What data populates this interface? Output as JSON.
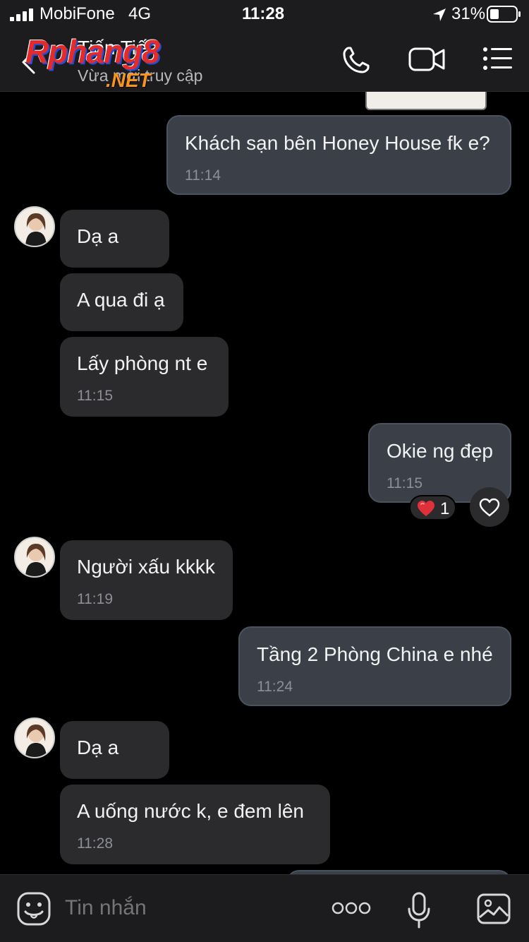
{
  "status": {
    "carrier": "MobiFone",
    "network": "4G",
    "time": "11:28",
    "battery": "31%"
  },
  "header": {
    "contact_name": "Tiến Tiến",
    "presence": "Vừa mới truy cập",
    "watermark_text": "Rphang8",
    "watermark_sub": ".NET"
  },
  "messages": [
    {
      "dir": "out",
      "text": "Khách sạn bên Honey House fk e?",
      "time": "11:14"
    },
    {
      "dir": "in",
      "text": "Dạ a"
    },
    {
      "dir": "in",
      "text": "A qua đi ạ"
    },
    {
      "dir": "in",
      "text": "Lấy phòng nt e",
      "time": "11:15"
    },
    {
      "dir": "out",
      "text": "Okie ng đẹp",
      "time": "11:15",
      "reaction_count": "1"
    },
    {
      "dir": "in",
      "text": "Người xấu kkkk",
      "time": "11:19"
    },
    {
      "dir": "out",
      "text": "Tầng 2 Phòng China e nhé",
      "time": "11:24"
    },
    {
      "dir": "in",
      "text": "Dạ a"
    },
    {
      "dir": "in",
      "text": "A uống nước k, e đem lên",
      "time": "11:28"
    }
  ],
  "composer": {
    "placeholder": "Tin nhắn"
  },
  "colors": {
    "background": "#000000",
    "incoming": "#2b2b2d",
    "outgoing": "#3a3f48",
    "accent_heart": "#e0303a"
  }
}
